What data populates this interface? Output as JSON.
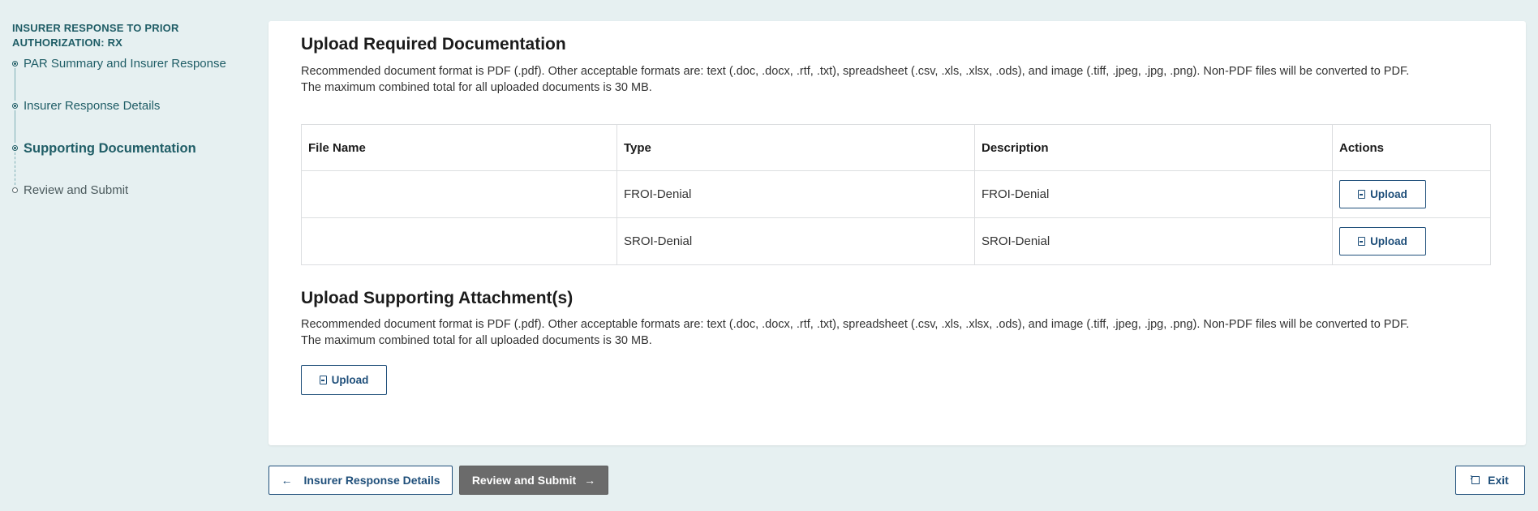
{
  "sidebar": {
    "title": "INSURER RESPONSE TO PRIOR AUTHORIZATION: RX",
    "steps": [
      {
        "label": "PAR Summary and Insurer Response",
        "state": "done"
      },
      {
        "label": "Insurer Response Details",
        "state": "done"
      },
      {
        "label": "Supporting Documentation",
        "state": "active"
      },
      {
        "label": "Review and Submit",
        "state": "pending"
      }
    ]
  },
  "required": {
    "title": "Upload Required Documentation",
    "desc1": "Recommended document format is PDF (.pdf). Other acceptable formats are: text (.doc, .docx, .rtf, .txt), spreadsheet (.csv, .xls, .xlsx, .ods), and image (.tiff, .jpeg, .jpg, .png). Non-PDF files will be converted to PDF.",
    "desc2": "The maximum combined total for all uploaded documents is 30 MB.",
    "columns": [
      "File Name",
      "Type",
      "Description",
      "Actions"
    ],
    "rows": [
      {
        "file_name": "",
        "type": "FROI-Denial",
        "description": "FROI-Denial",
        "action": "Upload"
      },
      {
        "file_name": "",
        "type": "SROI-Denial",
        "description": "SROI-Denial",
        "action": "Upload"
      }
    ]
  },
  "supporting": {
    "title": "Upload Supporting Attachment(s)",
    "desc1": "Recommended document format is PDF (.pdf). Other acceptable formats are: text (.doc, .docx, .rtf, .txt), spreadsheet (.csv, .xls, .xlsx, .ods), and image (.tiff, .jpeg, .jpg, .png). Non-PDF files will be converted to PDF.",
    "desc2": "The maximum combined total for all uploaded documents is 30 MB.",
    "upload_label": "Upload"
  },
  "footer": {
    "prev_label": "Insurer Response Details",
    "next_label": "Review and Submit",
    "exit_label": "Exit"
  }
}
